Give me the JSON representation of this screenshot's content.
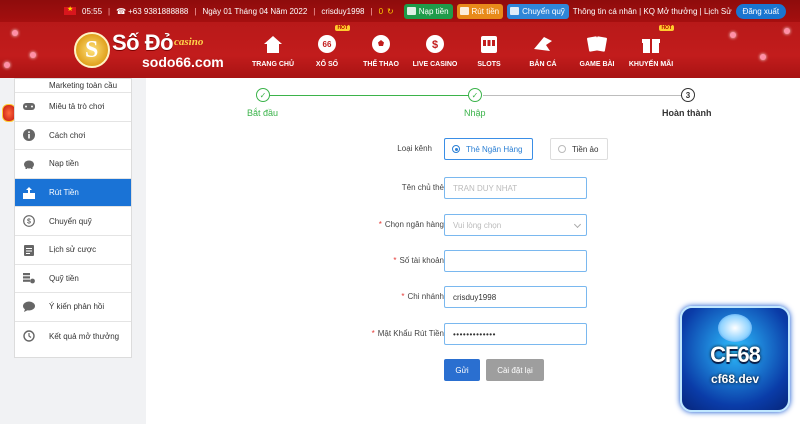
{
  "topbar": {
    "time": "05:55",
    "phone": "+63 9381888888",
    "date": "Ngày 01 Tháng 04 Năm 2022",
    "username": "crisduy1998",
    "balance": "0",
    "nap_tien": "Nạp tiền",
    "rut_tien": "Rút tiền",
    "chuyen_quy": "Chuyển quỹ",
    "links": "Thông tin cá nhân | KQ Mở thưởng | Lịch Sử",
    "logout": "Đăng xuất"
  },
  "brand": {
    "name": "Số Đỏ",
    "casino": "casino",
    "domain": "sodo66.com"
  },
  "nav": [
    {
      "label": "TRANG CHỦ",
      "icon": "home-icon"
    },
    {
      "label": "XỔ SỐ",
      "icon": "lottery-ball-icon",
      "hot": "HOT"
    },
    {
      "label": "THỂ THAO",
      "icon": "soccer-ball-icon"
    },
    {
      "label": "LIVE CASINO",
      "icon": "casino-chip-icon"
    },
    {
      "label": "SLOTS",
      "icon": "slot-machine-icon"
    },
    {
      "label": "BẮN CÁ",
      "icon": "fish-icon"
    },
    {
      "label": "GAME BÀI",
      "icon": "playing-cards-icon"
    },
    {
      "label": "KHUYẾN MÃI",
      "icon": "gift-icon",
      "hot": "HOT"
    }
  ],
  "sidebar": {
    "items": [
      {
        "label": "Marketing toàn cầu",
        "icon": ""
      },
      {
        "label": "Miêu tả trò chơi",
        "icon": "gamepad-icon"
      },
      {
        "label": "Cách chơi",
        "icon": "info-icon"
      },
      {
        "label": "Nạp tiền",
        "icon": "piggy-bank-icon"
      },
      {
        "label": "Rút Tiền",
        "icon": "withdraw-icon"
      },
      {
        "label": "Chuyển quỹ",
        "icon": "dollar-circle-icon"
      },
      {
        "label": "Lịch sử cược",
        "icon": "clipboard-icon"
      },
      {
        "label": "Quỹ tiền",
        "icon": "coins-icon"
      },
      {
        "label": "Ý kiến phản hồi",
        "icon": "chat-icon"
      },
      {
        "label": "Kết quả mở thưởng",
        "icon": "history-icon"
      }
    ],
    "active_index": 4
  },
  "steps": [
    {
      "label": "Bắt đầu",
      "marker": "✓"
    },
    {
      "label": "Nhập",
      "marker": "✓"
    },
    {
      "label": "Hoàn thành",
      "marker": "3"
    }
  ],
  "form": {
    "channel_label": "Loại kênh",
    "channel_options": [
      "Thẻ Ngân Hàng",
      "Tiền ảo"
    ],
    "holder_label": "Tên chủ thẻ",
    "holder_value": "TRAN DUY NHAT",
    "bank_label": "Chọn ngân hàng",
    "bank_placeholder": "Vui lòng chọn",
    "account_label": "Số tài khoản",
    "account_value": "",
    "branch_label": "Chi nhánh",
    "branch_value": "crisduy1998",
    "password_label": "Mật Khẩu Rút Tiền",
    "password_value": "•••••••••••••",
    "required_mark": "*",
    "submit": "Gửi",
    "reset": "Cài đặt lại"
  },
  "watermark": {
    "big": "CF68",
    "small": "cf68.dev"
  },
  "colors": {
    "header_red": "#c21c1c",
    "active_blue": "#1a73d6",
    "step_green": "#3bb34a"
  }
}
